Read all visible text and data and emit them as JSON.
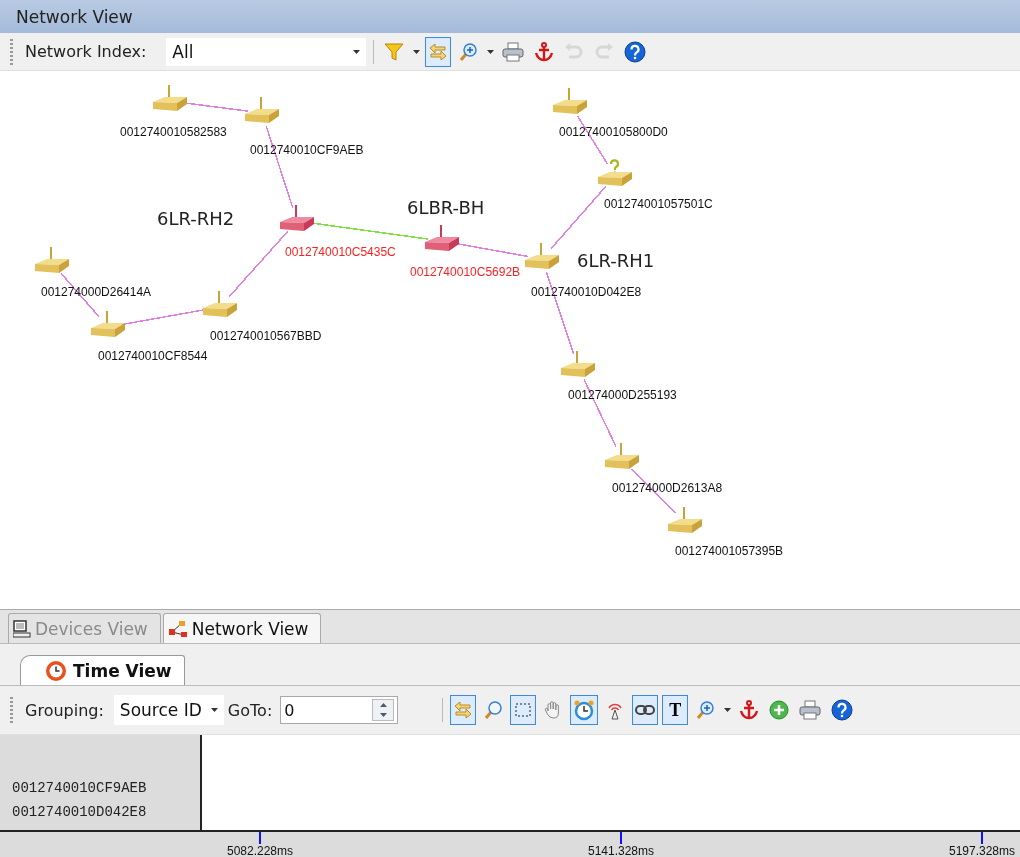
{
  "panel": {
    "title": "Network View"
  },
  "network_toolbar": {
    "index_label": "Network Index:",
    "index_value": "All",
    "tools": [
      {
        "kind": "filter",
        "on": false,
        "disabled": false
      },
      {
        "kind": "caret",
        "on": false,
        "disabled": false
      },
      {
        "kind": "swap",
        "on": true,
        "disabled": false
      },
      {
        "kind": "zoom-in",
        "on": false,
        "disabled": false
      },
      {
        "kind": "caret",
        "on": false,
        "disabled": false
      },
      {
        "kind": "print",
        "on": false,
        "disabled": false
      },
      {
        "kind": "anchor",
        "on": false,
        "disabled": false
      },
      {
        "kind": "undo",
        "on": false,
        "disabled": true
      },
      {
        "kind": "redo",
        "on": false,
        "disabled": true
      },
      {
        "kind": "help",
        "on": false,
        "disabled": false
      }
    ]
  },
  "network": {
    "nodes": [
      {
        "id": "0012740010582583",
        "kind": "router",
        "highlighted": false
      },
      {
        "id": "00127400105800D0",
        "kind": "router",
        "highlighted": false
      },
      {
        "id": "0012740010CF9AEB",
        "kind": "router",
        "highlighted": false
      },
      {
        "id": "001274001057501C",
        "kind": "unknown",
        "highlighted": false
      },
      {
        "id": "0012740010C5435C",
        "kind": "router",
        "highlighted": true,
        "name": "6LR-RH2"
      },
      {
        "id": "0012740010C5692B",
        "kind": "router",
        "highlighted": true,
        "name": "6LBR-BH"
      },
      {
        "id": "001274000D26414A",
        "kind": "router",
        "highlighted": false
      },
      {
        "id": "0012740010D042E8",
        "kind": "router",
        "highlighted": false,
        "name": "6LR-RH1"
      },
      {
        "id": "0012740010567BBD",
        "kind": "router",
        "highlighted": false
      },
      {
        "id": "0012740010CF8544",
        "kind": "router",
        "highlighted": false
      },
      {
        "id": "001274000D255193",
        "kind": "router",
        "highlighted": false
      },
      {
        "id": "001274000D2613A8",
        "kind": "router",
        "highlighted": false
      },
      {
        "id": "001274001057395B",
        "kind": "router",
        "highlighted": false
      }
    ],
    "links": [
      {
        "color": "#e080e0"
      },
      {
        "color": "#e080e0"
      },
      {
        "color": "#80e040"
      },
      {
        "color": "#e080e0"
      },
      {
        "color": "#e080e0"
      },
      {
        "color": "#e080e0"
      },
      {
        "color": "#e080e0"
      },
      {
        "color": "#e080e0"
      },
      {
        "color": "#e080e0"
      },
      {
        "color": "#e080e0"
      },
      {
        "color": "#e080e0"
      },
      {
        "color": "#e080e0"
      }
    ]
  },
  "view_tabs": [
    {
      "label": "Devices View",
      "kind": "devices",
      "selected": false
    },
    {
      "label": "Network View",
      "kind": "network",
      "selected": true
    }
  ],
  "time_view": {
    "tab": "Time View",
    "grouping_label": "Grouping:",
    "grouping_value": "Source ID",
    "goto_label": "GoTo:",
    "goto_value": "0",
    "tools": [
      {
        "kind": "swap",
        "on": true
      },
      {
        "kind": "zoom",
        "on": false
      },
      {
        "kind": "select-rect",
        "on": true
      },
      {
        "kind": "hand",
        "on": false
      },
      {
        "kind": "alarm",
        "on": true
      },
      {
        "kind": "antenna",
        "on": false
      },
      {
        "kind": "link",
        "on": true
      },
      {
        "kind": "text",
        "label": "T",
        "on": true
      },
      {
        "kind": "zoom-in",
        "on": false
      },
      {
        "kind": "caret",
        "on": false
      },
      {
        "kind": "anchor",
        "on": false
      },
      {
        "kind": "add",
        "on": false
      },
      {
        "kind": "print",
        "on": false
      },
      {
        "kind": "help",
        "on": false
      }
    ],
    "sources": [
      "0012740010CF9AEB",
      "0012740010D042E8"
    ],
    "ticks": [
      "5082.228ms",
      "5141.328ms",
      "5197.328ms"
    ]
  }
}
